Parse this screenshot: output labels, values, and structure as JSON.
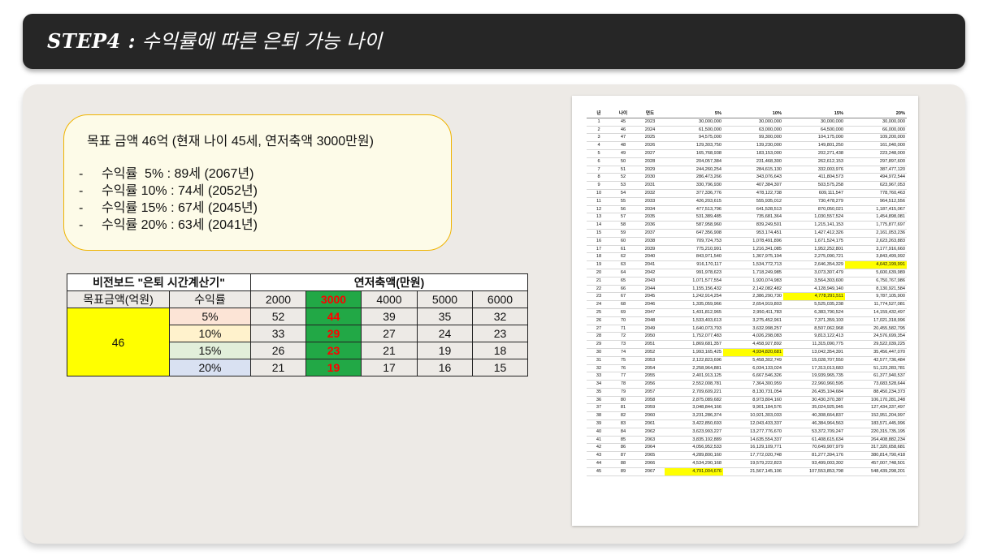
{
  "title": {
    "step": "STEP4 :",
    "text": "수익률에 따른 은퇴 가능 나이"
  },
  "summary": {
    "heading": "목표 금액 46억 (현재 나이 45세, 연저축액 3000만원)",
    "items": [
      "수익률  5% : 89세 (2067년)",
      "수익률 10% : 74세 (2052년)",
      "수익률 15% : 67세 (2045년)",
      "수익률 20% : 63세 (2041년)"
    ]
  },
  "calculator": {
    "title": "비전보드 \"은퇴 시간계산기\"",
    "savings_header": "연저축액(만원)",
    "target_header": "목표금액(억원)",
    "rate_header": "수익률",
    "target_value": "46",
    "columns": [
      "2000",
      "3000",
      "4000",
      "5000",
      "6000"
    ],
    "highlight_col": 1,
    "rows": [
      {
        "rate": "5%",
        "values": [
          "52",
          "44",
          "39",
          "35",
          "32"
        ]
      },
      {
        "rate": "10%",
        "values": [
          "33",
          "29",
          "27",
          "24",
          "23"
        ]
      },
      {
        "rate": "15%",
        "values": [
          "26",
          "23",
          "21",
          "19",
          "18"
        ]
      },
      {
        "rate": "20%",
        "values": [
          "21",
          "19",
          "17",
          "16",
          "15"
        ]
      }
    ]
  },
  "sheet": {
    "headers": [
      "년",
      "나이",
      "연도",
      "5%",
      "10%",
      "15%",
      "20%"
    ],
    "highlights": {
      "r19c6": true,
      "r23c5": true,
      "r30c4": true,
      "r45c3": true
    },
    "rows": [
      [
        "1",
        "45",
        "2023",
        "30,000,000",
        "30,000,000",
        "30,000,000",
        "30,000,000"
      ],
      [
        "2",
        "46",
        "2024",
        "61,500,000",
        "63,000,000",
        "64,500,000",
        "66,000,000"
      ],
      [
        "3",
        "47",
        "2025",
        "94,575,000",
        "99,300,000",
        "104,175,000",
        "109,200,000"
      ],
      [
        "4",
        "48",
        "2026",
        "129,303,750",
        "139,230,000",
        "149,801,250",
        "161,040,000"
      ],
      [
        "5",
        "49",
        "2027",
        "165,768,938",
        "183,153,000",
        "202,271,438",
        "223,248,000"
      ],
      [
        "6",
        "50",
        "2028",
        "204,057,384",
        "231,468,300",
        "262,612,153",
        "297,897,600"
      ],
      [
        "7",
        "51",
        "2029",
        "244,260,254",
        "284,615,130",
        "332,003,976",
        "387,477,120"
      ],
      [
        "8",
        "52",
        "2030",
        "286,473,266",
        "343,076,643",
        "411,804,573",
        "494,972,544"
      ],
      [
        "9",
        "53",
        "2031",
        "330,796,930",
        "407,384,307",
        "503,575,258",
        "623,967,053"
      ],
      [
        "10",
        "54",
        "2032",
        "377,336,776",
        "478,122,738",
        "609,111,547",
        "778,760,463"
      ],
      [
        "11",
        "55",
        "2033",
        "426,203,615",
        "555,935,012",
        "730,478,279",
        "964,512,556"
      ],
      [
        "12",
        "56",
        "2034",
        "477,513,796",
        "641,528,513",
        "870,050,021",
        "1,187,415,067"
      ],
      [
        "13",
        "57",
        "2035",
        "531,389,485",
        "735,681,364",
        "1,030,557,524",
        "1,454,898,081"
      ],
      [
        "14",
        "58",
        "2036",
        "587,958,960",
        "839,249,501",
        "1,215,141,153",
        "1,775,877,697"
      ],
      [
        "15",
        "59",
        "2037",
        "647,356,908",
        "953,174,451",
        "1,427,412,326",
        "2,161,053,236"
      ],
      [
        "16",
        "60",
        "2038",
        "709,724,753",
        "1,078,491,896",
        "1,671,524,175",
        "2,623,263,883"
      ],
      [
        "17",
        "61",
        "2039",
        "775,210,991",
        "1,216,341,085",
        "1,952,252,801",
        "3,177,916,660"
      ],
      [
        "18",
        "62",
        "2040",
        "843,971,540",
        "1,367,975,194",
        "2,275,090,721",
        "3,843,499,992"
      ],
      [
        "19",
        "63",
        "2041",
        "916,170,117",
        "1,534,772,713",
        "2,646,354,329",
        "4,642,199,991"
      ],
      [
        "20",
        "64",
        "2042",
        "991,978,623",
        "1,718,249,985",
        "3,073,307,479",
        "5,600,639,989"
      ],
      [
        "21",
        "65",
        "2043",
        "1,071,577,554",
        "1,920,074,983",
        "3,564,303,600",
        "6,750,767,986"
      ],
      [
        "22",
        "66",
        "2044",
        "1,155,156,432",
        "2,142,082,482",
        "4,128,949,140",
        "8,130,921,584"
      ],
      [
        "23",
        "67",
        "2045",
        "1,242,914,254",
        "2,386,290,730",
        "4,778,291,511",
        "9,787,105,900"
      ],
      [
        "24",
        "68",
        "2046",
        "1,335,059,966",
        "2,654,919,803",
        "5,525,035,238",
        "11,774,527,081"
      ],
      [
        "25",
        "69",
        "2047",
        "1,431,812,965",
        "2,950,411,783",
        "6,383,790,524",
        "14,159,432,497"
      ],
      [
        "26",
        "70",
        "2048",
        "1,533,403,613",
        "3,275,452,961",
        "7,371,359,103",
        "17,021,318,996"
      ],
      [
        "27",
        "71",
        "2049",
        "1,640,073,793",
        "3,632,998,257",
        "8,507,062,968",
        "20,455,582,795"
      ],
      [
        "28",
        "72",
        "2050",
        "1,752,077,483",
        "4,026,298,083",
        "9,813,122,413",
        "24,576,699,354"
      ],
      [
        "29",
        "73",
        "2051",
        "1,869,681,357",
        "4,458,927,892",
        "11,315,090,775",
        "29,522,039,225"
      ],
      [
        "30",
        "74",
        "2052",
        "1,993,165,425",
        "4,934,820,681",
        "13,042,354,391",
        "35,456,447,070"
      ],
      [
        "31",
        "75",
        "2053",
        "2,122,823,696",
        "5,458,302,749",
        "15,028,707,550",
        "42,577,736,484"
      ],
      [
        "32",
        "76",
        "2054",
        "2,258,964,881",
        "6,034,133,024",
        "17,313,013,683",
        "51,123,283,781"
      ],
      [
        "33",
        "77",
        "2055",
        "2,401,913,125",
        "6,667,546,326",
        "19,939,965,735",
        "61,377,940,537"
      ],
      [
        "34",
        "78",
        "2056",
        "2,552,008,781",
        "7,364,300,959",
        "22,960,960,595",
        "73,683,528,644"
      ],
      [
        "35",
        "79",
        "2057",
        "2,709,609,221",
        "8,130,731,054",
        "26,435,104,684",
        "88,450,234,373"
      ],
      [
        "36",
        "80",
        "2058",
        "2,875,089,682",
        "8,973,804,160",
        "30,430,370,387",
        "106,170,281,248"
      ],
      [
        "37",
        "81",
        "2059",
        "3,048,844,166",
        "9,901,184,576",
        "35,024,925,945",
        "127,434,337,497"
      ],
      [
        "38",
        "82",
        "2060",
        "3,231,286,374",
        "10,921,303,033",
        "40,308,664,837",
        "152,951,204,997"
      ],
      [
        "39",
        "83",
        "2061",
        "3,422,850,693",
        "12,043,433,337",
        "46,384,964,563",
        "183,571,445,996"
      ],
      [
        "40",
        "84",
        "2062",
        "3,623,993,227",
        "13,277,776,670",
        "53,372,709,247",
        "220,315,735,195"
      ],
      [
        "41",
        "85",
        "2063",
        "3,835,192,889",
        "14,635,554,337",
        "61,408,615,634",
        "264,408,882,234"
      ],
      [
        "42",
        "86",
        "2064",
        "4,056,952,533",
        "16,129,109,771",
        "70,649,907,979",
        "317,320,658,681"
      ],
      [
        "43",
        "87",
        "2065",
        "4,289,800,160",
        "17,772,020,748",
        "81,277,394,176",
        "380,814,790,418"
      ],
      [
        "44",
        "88",
        "2066",
        "4,534,290,168",
        "19,579,222,823",
        "93,499,003,302",
        "457,007,748,501"
      ],
      [
        "45",
        "89",
        "2067",
        "4,791,004,676",
        "21,567,145,106",
        "107,553,853,798",
        "548,439,298,201"
      ]
    ]
  }
}
